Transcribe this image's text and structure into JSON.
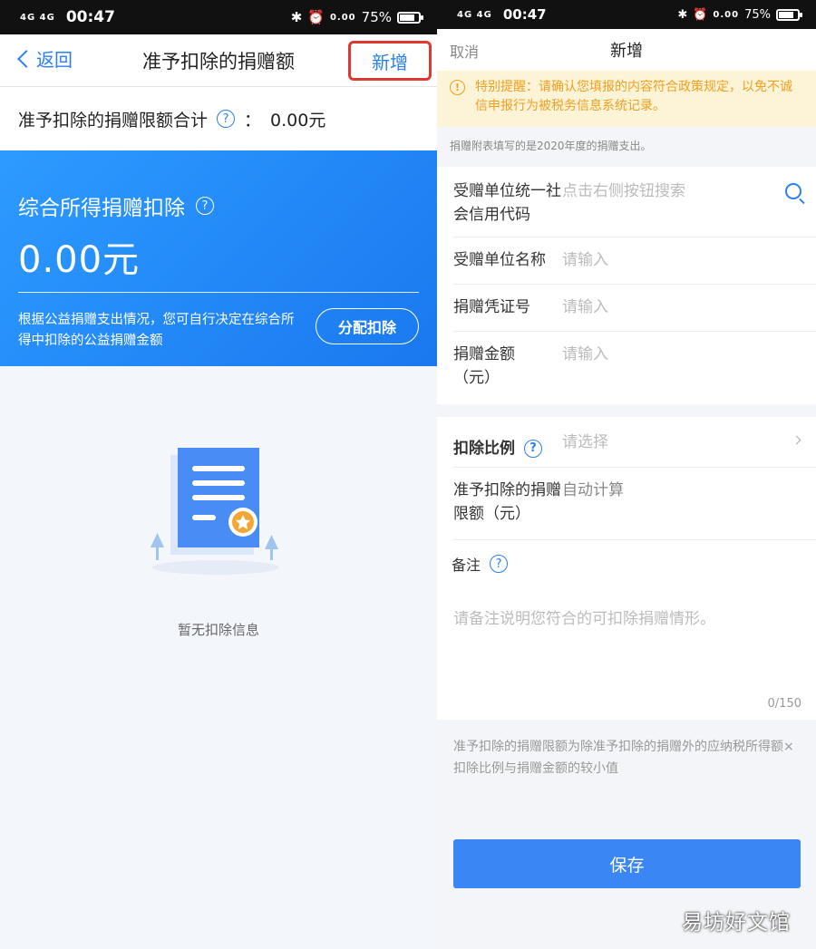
{
  "status_left": {
    "signal": "4G 4G",
    "time": "00:47",
    "net_speed": "0.00",
    "battery": "75%"
  },
  "status_right": {
    "signal": "4G 4G",
    "time": "00:47",
    "net_speed": "0.00",
    "battery": "75%"
  },
  "left": {
    "back_label": "返回",
    "title": "准予扣除的捐赠额",
    "add_label": "新增",
    "total_label": "准予扣除的捐赠限额合计",
    "total_sep": "：",
    "total_value": "0.00元",
    "card": {
      "title": "综合所得捐赠扣除",
      "amount": "0.00元",
      "desc": "根据公益捐赠支出情况，您可自行决定在综合所得中扣除的公益捐赠金额",
      "alloc_button": "分配扣除"
    },
    "empty_text": "暂无扣除信息"
  },
  "right": {
    "cancel_label": "取消",
    "title": "新增",
    "notice": "特别提醒：请确认您填报的内容符合政策规定，以免不诚信申报行为被税务信息系统记录。",
    "fill_hint": "捐赠附表填写的是2020年度的捐赠支出。",
    "fields": {
      "credit_code_label": "受赠单位统一社会信用代码",
      "credit_code_placeholder": "点击右侧按钮搜索",
      "org_name_label": "受赠单位名称",
      "org_name_placeholder": "请输入",
      "voucher_label": "捐赠凭证号",
      "voucher_placeholder": "请输入",
      "amount_label": "捐赠金额（元）",
      "amount_placeholder": "请输入",
      "ratio_label": "扣除比例",
      "ratio_placeholder": "请选择",
      "limit_label": "准予扣除的捐赠限额（元）",
      "limit_value": "自动计算"
    },
    "remark_label": "备注",
    "remark_placeholder": "请备注说明您符合的可扣除捐赠情形。",
    "remark_count": "0/150",
    "formula": "准予扣除的捐赠限额为除准予扣除的捐赠外的应纳税所得额×扣除比例与捐赠金额的较小值",
    "save_label": "保存"
  },
  "watermark": "易坊好文馆",
  "colors": {
    "accent": "#2a7ff2",
    "highlight_border": "#e0382f",
    "notice_text": "#f0a020",
    "notice_bg": "#fdf3d6"
  }
}
